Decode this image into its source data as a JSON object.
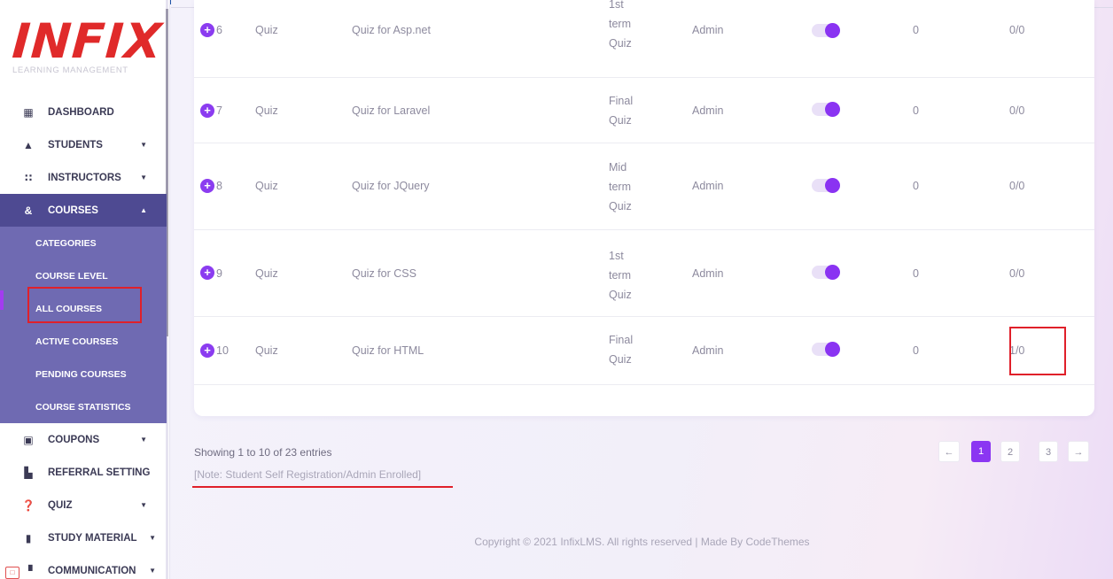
{
  "brand": {
    "name": "INFIX",
    "tagline": "LEARNING MANAGEMENT"
  },
  "sidebar": {
    "items": [
      {
        "label": "DASHBOARD",
        "icon": "grid-icon",
        "glyph": "▦"
      },
      {
        "label": "STUDENTS",
        "icon": "graduation-cap-icon",
        "glyph": "🎓"
      },
      {
        "label": "INSTRUCTORS",
        "icon": "users-icon",
        "glyph": "👥"
      },
      {
        "label": "COURSES",
        "icon": "ampersand-icon",
        "glyph": "&"
      },
      {
        "label": "COUPONS",
        "icon": "gift-icon",
        "glyph": "🎁"
      },
      {
        "label": "REFERRAL SETTING",
        "icon": "referral-icon",
        "glyph": "▙"
      },
      {
        "label": "QUIZ",
        "icon": "question-icon",
        "glyph": "?"
      },
      {
        "label": "STUDY MATERIAL",
        "icon": "book-icon",
        "glyph": "▮"
      },
      {
        "label": "COMMUNICATION",
        "icon": "chat-icon",
        "glyph": "▝"
      }
    ],
    "courses_submenu": [
      "CATEGORIES",
      "COURSE LEVEL",
      "ALL COURSES",
      "ACTIVE COURSES",
      "PENDING COURSES",
      "COURSE STATISTICS"
    ]
  },
  "table": {
    "rows": [
      {
        "num": "6",
        "type": "Quiz",
        "title": "Quiz for Asp.net",
        "category": [
          "1st",
          "term",
          "Quiz"
        ],
        "author": "Admin",
        "status_on": true,
        "lessons": "0",
        "enrolled": "0/0"
      },
      {
        "num": "7",
        "type": "Quiz",
        "title": "Quiz for Laravel",
        "category": [
          "Final",
          "Quiz"
        ],
        "author": "Admin",
        "status_on": true,
        "lessons": "0",
        "enrolled": "0/0"
      },
      {
        "num": "8",
        "type": "Quiz",
        "title": "Quiz for JQuery",
        "category": [
          "Mid",
          "term",
          "Quiz"
        ],
        "author": "Admin",
        "status_on": true,
        "lessons": "0",
        "enrolled": "0/0"
      },
      {
        "num": "9",
        "type": "Quiz",
        "title": "Quiz for CSS",
        "category": [
          "1st",
          "term",
          "Quiz"
        ],
        "author": "Admin",
        "status_on": true,
        "lessons": "0",
        "enrolled": "0/0"
      },
      {
        "num": "10",
        "type": "Quiz",
        "title": "Quiz for HTML",
        "category": [
          "Final",
          "Quiz"
        ],
        "author": "Admin",
        "status_on": true,
        "lessons": "0",
        "enrolled": "1/0"
      }
    ]
  },
  "footer": {
    "entries": "Showing 1 to 10 of 23 entries",
    "note": "[Note: Student Self Registration/Admin Enrolled]",
    "pagination": [
      "←",
      "1",
      "2",
      "3",
      "→"
    ],
    "copyright": "Copyright © 2021 InfixLMS. All rights reserved | Made By CodeThemes"
  },
  "colors": {
    "accent": "#8b36f2",
    "sidebar_active": "#4e4a92",
    "submenu_bg": "#6f6ab2",
    "highlight_red": "#e0202a",
    "logo_red": "#e02a2a"
  }
}
